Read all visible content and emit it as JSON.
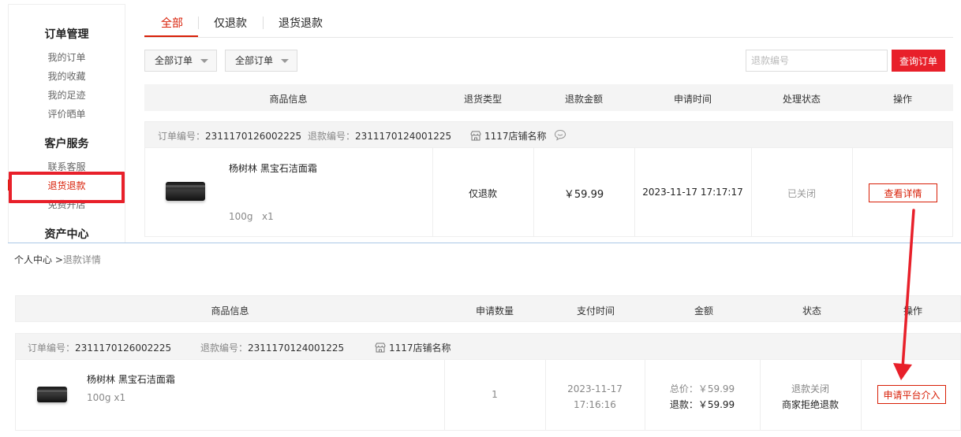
{
  "sidebar": {
    "groups": [
      {
        "title": "订单管理",
        "items": [
          "我的订单",
          "我的收藏",
          "我的足迹",
          "评价晒单"
        ]
      },
      {
        "title": "客户服务",
        "items": [
          "联系客服",
          "退货退款",
          "免费开店"
        ]
      },
      {
        "title": "资产中心",
        "items": []
      }
    ],
    "active_item": "退货退款"
  },
  "tabs": [
    "全部",
    "仅退款",
    "退货退款"
  ],
  "filters": {
    "select1": "全部订单",
    "select2": "全部订单",
    "search_placeholder": "退款编号",
    "search_button": "查询订单"
  },
  "list_table": {
    "headers": [
      "商品信息",
      "退货类型",
      "退款金额",
      "申请时间",
      "处理状态",
      "操作"
    ],
    "order": {
      "order_no_label": "订单编号：",
      "order_no": "2311170126002225",
      "refund_no_label": "退款编号：",
      "refund_no": "2311170124001225",
      "shop_name": "1117店铺名称",
      "product_name": "杨树林 黑宝石洁面霜",
      "spec": "100g",
      "qty": "x1",
      "refund_type": "仅退款",
      "amount": "￥59.99",
      "apply_time": "2023-11-17 17:17:17",
      "status": "已关闭",
      "action": "查看详情"
    }
  },
  "breadcrumb": {
    "root": "个人中心",
    "sep": ">",
    "current": "退款详情"
  },
  "detail_table": {
    "headers": [
      "商品信息",
      "申请数量",
      "支付时间",
      "金额",
      "状态",
      "操作"
    ],
    "order": {
      "order_no_label": "订单编号：",
      "order_no": "2311170126002225",
      "refund_no_label": "退款编号：",
      "refund_no": "2311170124001225",
      "shop_name": "1117店铺名称",
      "product_name": "杨树林 黑宝石洁面霜",
      "spec": "100g x1",
      "quantity": "1",
      "pay_date": "2023-11-17",
      "pay_time": "17:16:16",
      "total_label": "总价：",
      "total": "￥59.99",
      "refund_label": "退款：",
      "refund": "￥59.99",
      "status1": "退款关闭",
      "status2": "商家拒绝退款",
      "action": "申请平台介入"
    }
  },
  "colors": {
    "accent": "#d81e06",
    "annotation": "#e8202a"
  },
  "icons": {
    "shop": "shop-icon",
    "chat": "chat-icon",
    "caret": "caret-down-icon"
  }
}
